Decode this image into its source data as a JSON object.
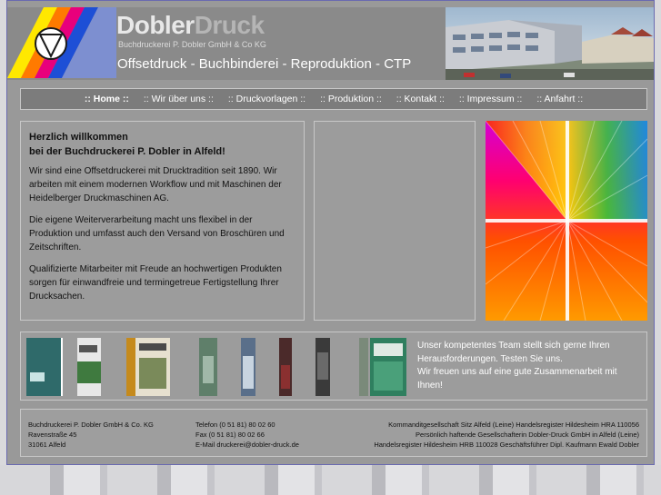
{
  "brand": {
    "name_part1": "Dobler",
    "name_part2": "Druck",
    "subtitle": "Buchdruckerei P. Dobler GmbH & Co KG",
    "tagline": "Offsetdruck - Buchbinderei - Reproduktion - CTP"
  },
  "nav": {
    "items": [
      {
        "label": ":: Home ::"
      },
      {
        "label": ":: Wir über uns ::"
      },
      {
        "label": ":: Druckvorlagen ::"
      },
      {
        "label": ":: Produktion ::"
      },
      {
        "label": ":: Kontakt ::"
      },
      {
        "label": ":: Impressum ::"
      },
      {
        "label": ":: Anfahrt ::"
      }
    ]
  },
  "intro": {
    "heading_line1": "Herzlich willkommen",
    "heading_line2": "bei der Buchdruckerei P. Dobler in Alfeld!",
    "p1": "Wir sind eine Offsetdruckerei mit Drucktradition seit 1890. Wir arbeiten mit einem modernen Workflow und mit Maschinen der Heidelberger Druckmaschinen AG.",
    "p2": "Die eigene Weiterverarbeitung macht uns flexibel in der Produktion und umfasst auch den Versand von Broschüren und Zeitschriften.",
    "p3": "Qualifizierte Mitarbeiter mit Freude an hochwertigen Produkten sorgen für einwandfreie und termingetreue Fertigstellung Ihrer Drucksachen."
  },
  "team": {
    "line1": "Unser kompetentes Team stellt sich gerne Ihren Herausforderungen. Testen Sie uns.",
    "line2": "Wir freuen uns auf eine gute Zusammenarbeit mit Ihnen!"
  },
  "footer": {
    "company": "Buchdruckerei P. Dobler GmbH & Co. KG",
    "street": "Ravenstraße 45",
    "city": "31061 Alfeld",
    "phone": "Telefon (0 51 81) 80 02 60",
    "fax": "Fax (0 51 81) 80 02 66",
    "email": "E-Mail druckerei@dobler-druck.de",
    "legal1": "Kommanditgesellschaft Sitz Alfeld (Leine) Handelsregister Hildesheim HRA 110056",
    "legal2": "Persönlich haftende Gesellschafterin Dobler-Druck GmbH in Alfeld (Leine)",
    "legal3": "Handelsregister Hildesheim HRB 110028 Geschäftsführer Dipl. Kaufmann Ewald Dobler"
  },
  "colors": {
    "panel_bg": "#9c9c9c",
    "nav_bg": "#7c7c7c",
    "header_bg": "#8a8a8a"
  }
}
